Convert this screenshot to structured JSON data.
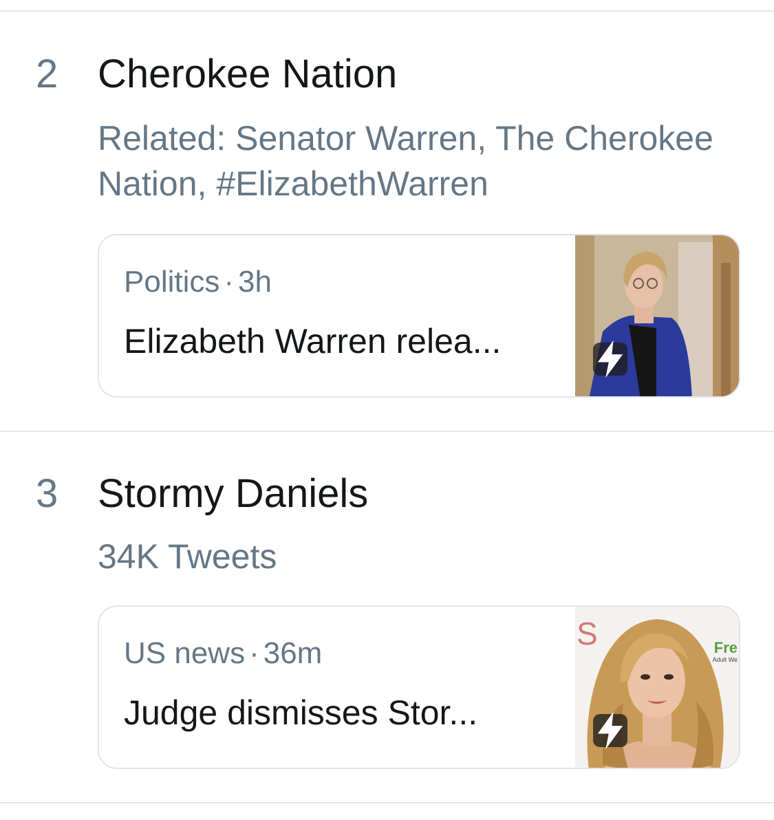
{
  "trends": [
    {
      "rank": "2",
      "topic": "Cherokee Nation",
      "context": "Related: Senator Warren, The Cherokee Nation, #ElizabethWarren",
      "card": {
        "category": "Politics",
        "separator": "·",
        "time": "3h",
        "headline": "Elizabeth Warren relea...",
        "thumbnail": "photo-woman-blue-jacket",
        "badge_icon": "lightning-bolt-icon"
      }
    },
    {
      "rank": "3",
      "topic": "Stormy Daniels",
      "context": "34K Tweets",
      "card": {
        "category": "US news",
        "separator": "·",
        "time": "36m",
        "headline": "Judge dismisses Stor...",
        "thumbnail": "photo-blonde-woman-red-carpet",
        "thumbnail_text_left": "S",
        "thumbnail_text_right": "Fre",
        "thumbnail_text_small": "Adult We",
        "badge_icon": "lightning-bolt-icon"
      }
    }
  ],
  "colors": {
    "primary_text": "#14171a",
    "secondary_text": "#657786",
    "divider": "#e1e6ea",
    "card_border": "#dfe4e8"
  }
}
